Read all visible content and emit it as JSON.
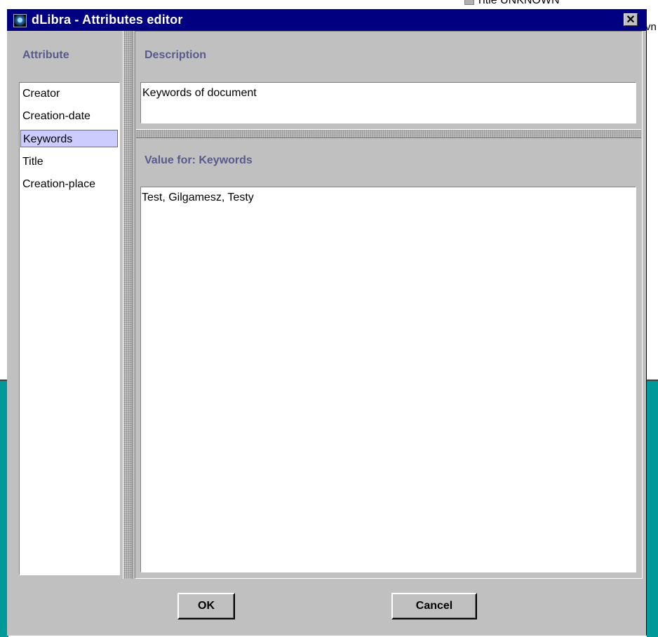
{
  "background": {
    "top_text": "Title UNKNOWN",
    "side_text": "vn"
  },
  "window": {
    "title": "dLibra - Attributes editor",
    "app_icon": "dlibra-globe-icon",
    "close_glyph": "✕"
  },
  "attributes": {
    "heading": "Attribute",
    "items": [
      "Creator",
      "Creation-date",
      "Keywords",
      "Title",
      "Creation-place"
    ],
    "selected": "Keywords"
  },
  "description": {
    "heading": "Description",
    "text": "Keywords of document"
  },
  "value": {
    "heading": "Value for: Keywords",
    "text": "Test, Gilgamesz, Testy"
  },
  "buttons": {
    "ok": "OK",
    "cancel": "Cancel"
  },
  "colors": {
    "title_bar": "#000080",
    "heading_text": "#5a5a8c",
    "selection": "#ccccff",
    "background_teal": "#009999"
  }
}
